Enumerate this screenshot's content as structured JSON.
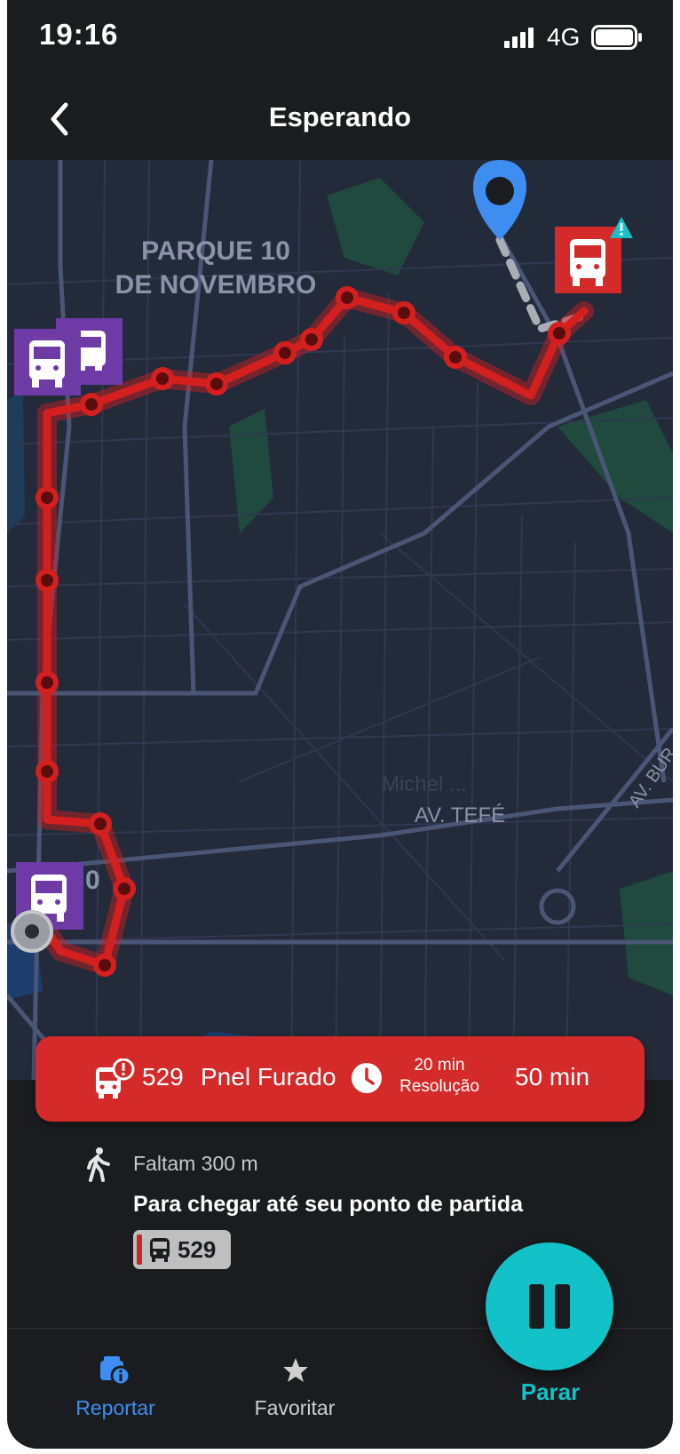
{
  "status_bar": {
    "time": "19:16",
    "network": "4G"
  },
  "header": {
    "title": "Esperando"
  },
  "map": {
    "labels": {
      "district_line1": "PARQUE 10",
      "district_line2": "DE NOVEMBRO",
      "place": "Michel ...",
      "street1": "AV. TEFÉ",
      "street2": "AV. BUR",
      "partial": "0"
    },
    "colors": {
      "route": "#d41f1f",
      "user_pin": "#3d8ef0",
      "bus_stop": "#6e3aa6",
      "alert_bus": "#d42a2a",
      "warning": "#14c2c8"
    }
  },
  "alert": {
    "line": "529",
    "reason": "Pnel Furado",
    "resolution_time": "20 min",
    "resolution_label": "Resolução",
    "total_time": "50 min"
  },
  "walk": {
    "distance": "Faltam 300 m",
    "instruction": "Para chegar até seu ponto de partida",
    "line_badge": "529"
  },
  "bottom_nav": {
    "report_label": "Reportar",
    "favorite_label": "Favoritar",
    "stop_label": "Parar"
  },
  "colors": {
    "accent_blue": "#3d8ef0",
    "accent_teal": "#13c2c8",
    "alert_red": "#d42a2a",
    "background": "#1b1c1f"
  }
}
